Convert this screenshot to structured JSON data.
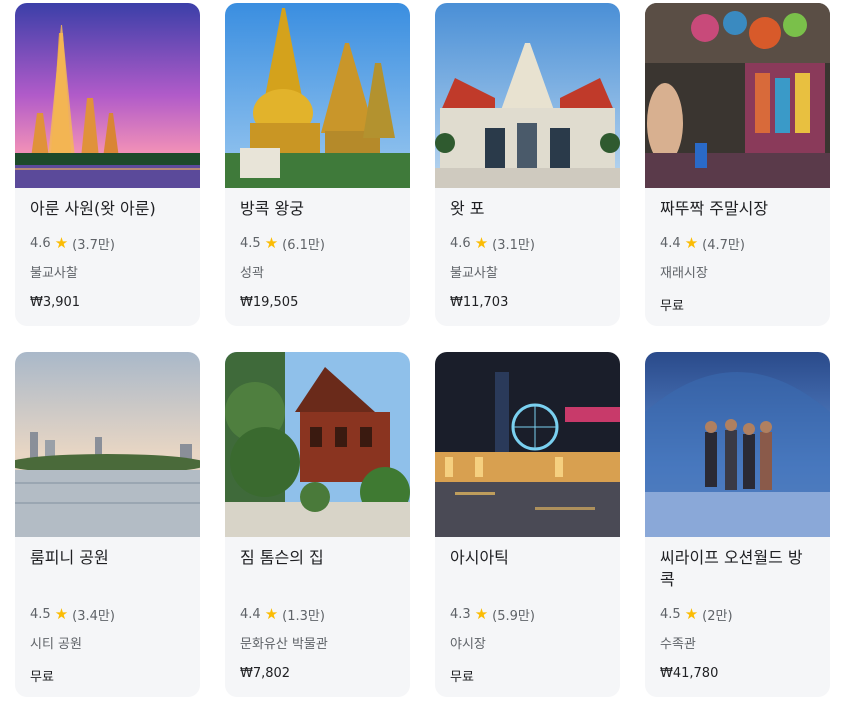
{
  "places": [
    {
      "title": "아룬 사원(왓 아룬)",
      "rating": "4.6",
      "reviews": "(3.7만)",
      "category": "불교사찰",
      "price": "₩3,901"
    },
    {
      "title": "방콕 왕궁",
      "rating": "4.5",
      "reviews": "(6.1만)",
      "category": "성곽",
      "price": "₩19,505"
    },
    {
      "title": "왓 포",
      "rating": "4.6",
      "reviews": "(3.1만)",
      "category": "불교사찰",
      "price": "₩11,703"
    },
    {
      "title": "짜뚜짝 주말시장",
      "rating": "4.4",
      "reviews": "(4.7만)",
      "category": "재래시장",
      "price": "무료"
    },
    {
      "title": "룸피니 공원",
      "rating": "4.5",
      "reviews": "(3.4만)",
      "category": "시티 공원",
      "price": "무료"
    },
    {
      "title": "짐 톰슨의 집",
      "rating": "4.4",
      "reviews": "(1.3만)",
      "category": "문화유산 박물관",
      "price": "₩7,802"
    },
    {
      "title": "아시아틱",
      "rating": "4.3",
      "reviews": "(5.9만)",
      "category": "야시장",
      "price": "무료"
    },
    {
      "title": "씨라이프 오션월드 방콕",
      "rating": "4.5",
      "reviews": "(2만)",
      "category": "수족관",
      "price": "₩41,780"
    }
  ],
  "star_icon": "star-icon",
  "colors": {
    "star": "#fbbc04",
    "card_bg": "#f5f6f8"
  }
}
